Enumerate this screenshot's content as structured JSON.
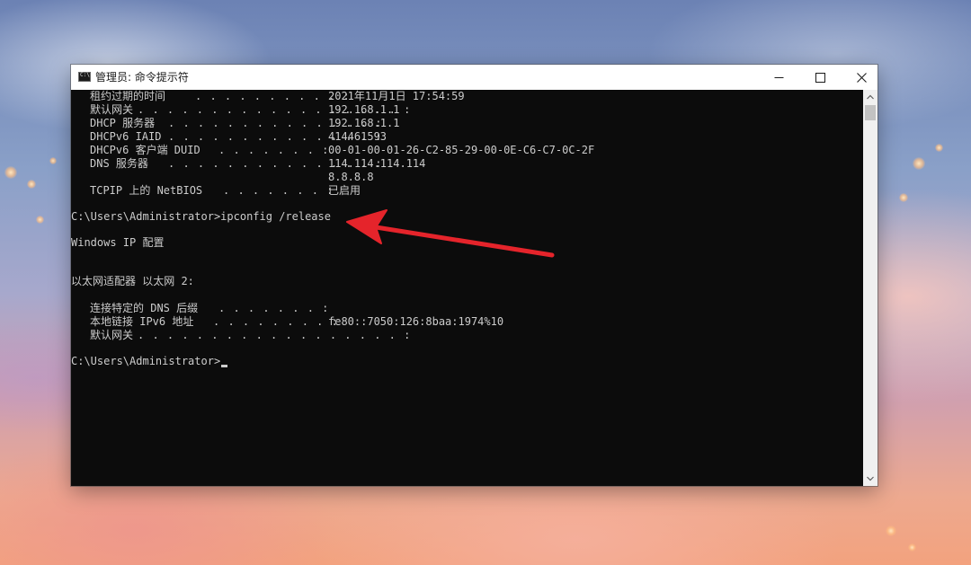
{
  "window": {
    "title": "管理员: 命令提示符",
    "icon": "cmd-icon"
  },
  "controls": {
    "minimize": "minimize-icon",
    "maximize": "maximize-icon",
    "close": "close-icon"
  },
  "console": {
    "rows": [
      {
        "label": "租约过期的时间",
        "value": "2021年11月1日 17:54:59"
      },
      {
        "label": "默认网关",
        "value": "192.168.1.1"
      },
      {
        "label": "DHCP 服务器",
        "value": "192.168.1.1"
      },
      {
        "label": "DHCPv6 IAID",
        "value": "414461593"
      },
      {
        "label": "DHCPv6 客户端 DUID",
        "value": "00-01-00-01-26-C2-85-29-00-0E-C6-C7-0C-2F"
      },
      {
        "label": "DNS 服务器",
        "value": "114.114.114.114"
      },
      {
        "label": "",
        "value": "8.8.8.8"
      },
      {
        "label": "TCPIP 上的 NetBIOS",
        "value": "已启用"
      }
    ],
    "command": "C:\\Users\\Administrator>ipconfig /release",
    "header": "Windows IP 配置",
    "adapter": "以太网适配器 以太网 2:",
    "adapter_rows": [
      {
        "label": "连接特定的 DNS 后缀",
        "value": ""
      },
      {
        "label": "本地链接 IPv6 地址",
        "value": "fe80::7050:126:8baa:1974%10"
      },
      {
        "label": "默认网关",
        "value": ""
      }
    ],
    "prompt": "C:\\Users\\Administrator>"
  },
  "annotation": {
    "color": "#e5242b",
    "icon": "red-arrow-icon"
  }
}
